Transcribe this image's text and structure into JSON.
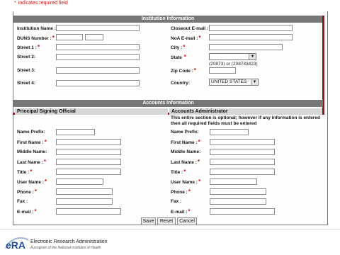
{
  "required_note": {
    "star": "*",
    "text": "indicates required field"
  },
  "institution": {
    "header": "Institution Information",
    "labels": {
      "institution_name": "Institution Name :",
      "duns_number": "DUNS Number :",
      "street1": "Street 1 :",
      "street2": "Street 2:",
      "street3": "Street 3:",
      "street4": "Street 4:",
      "closeout_email": "Closeout E-mail :",
      "noa_email": "NoA E-mail :",
      "city": "City :",
      "state": "State",
      "zip_code": "Zip Code :",
      "country": "Country:"
    },
    "zip_hint": "(20873) or (208733423)",
    "country_value": "UNITED STATES",
    "state_value": ""
  },
  "accounts": {
    "header": "Accounts Information",
    "pso_header": "Principal Signing Official",
    "aa_header": "Accounts Administrator",
    "aa_note": "This entire section is optional; however if any information is entered then all required fields must be entered",
    "labels": {
      "name_prefix": "Name Prefix:",
      "first_name": "First Name :",
      "middle_name": "Middle Name:",
      "last_name": "Last Name :",
      "title": "Title :",
      "user_name": "User Name :",
      "phone": "Phone :",
      "fax": "Fax :",
      "email": "E-mail :"
    }
  },
  "buttons": {
    "save": "Save",
    "reset": "Reset",
    "cancel": "Cancel"
  },
  "footer": {
    "logo_text": "eRA",
    "title": "Electronic Research Administration",
    "subtitle": "A program of the National Institutes of Health"
  },
  "colors": {
    "required": "#d01010",
    "header_bar": "#777777",
    "border_accent": "#8a1c20",
    "logo_blue": "#1f4e9a"
  }
}
